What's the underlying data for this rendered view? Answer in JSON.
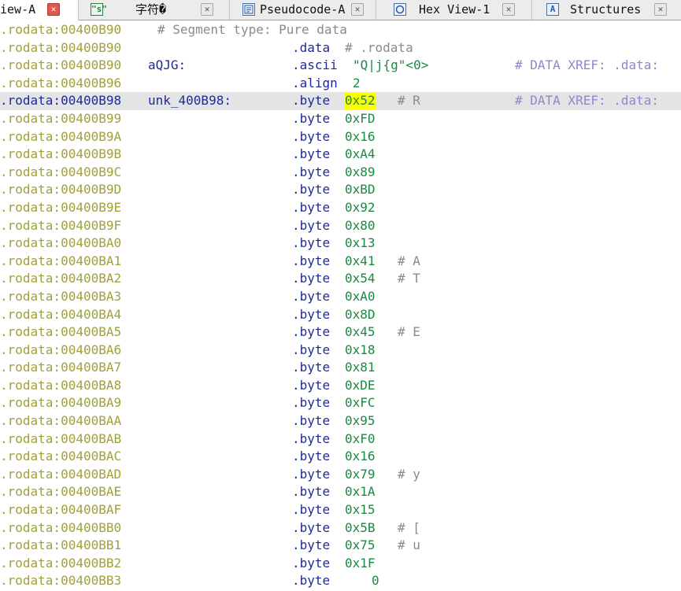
{
  "tabs": [
    {
      "label": "iew-A",
      "icon": "ida-view-icon",
      "active": true
    },
    {
      "label": "字符�",
      "icon": "strings-icon",
      "icon_glyph": "\"s\""
    },
    {
      "label": "Pseudocode-A",
      "icon": "pseudocode-icon"
    },
    {
      "label": "Hex View-1",
      "icon": "hex-view-icon"
    },
    {
      "label": "Structures",
      "icon": "structures-icon",
      "icon_glyph": "A"
    }
  ],
  "close_glyph": "✕",
  "listing": {
    "segment_comment": "# Segment type: Pure data",
    "data_directive": ".data",
    "data_comment": "# .rodata",
    "string_label": "aQJG:",
    "string_directive": ".ascii",
    "string_value": "\"Q|j{g\"<0>",
    "align_directive": ".align",
    "align_value": "2",
    "xref_text": "# DATA XREF: .data:",
    "byte_label": "unk_400B98:",
    "byte_directive": ".byte",
    "addresses": {
      "seg": ".rodata:00400B90",
      "data": ".rodata:00400B90",
      "ascii": ".rodata:00400B90",
      "align": ".rodata:00400B96"
    },
    "bytes": [
      {
        "addr": ".rodata:00400B98",
        "value": "0x52",
        "comment": "# R"
      },
      {
        "addr": ".rodata:00400B99",
        "value": "0xFD",
        "comment": ""
      },
      {
        "addr": ".rodata:00400B9A",
        "value": "0x16",
        "comment": ""
      },
      {
        "addr": ".rodata:00400B9B",
        "value": "0xA4",
        "comment": ""
      },
      {
        "addr": ".rodata:00400B9C",
        "value": "0x89",
        "comment": ""
      },
      {
        "addr": ".rodata:00400B9D",
        "value": "0xBD",
        "comment": ""
      },
      {
        "addr": ".rodata:00400B9E",
        "value": "0x92",
        "comment": ""
      },
      {
        "addr": ".rodata:00400B9F",
        "value": "0x80",
        "comment": ""
      },
      {
        "addr": ".rodata:00400BA0",
        "value": "0x13",
        "comment": ""
      },
      {
        "addr": ".rodata:00400BA1",
        "value": "0x41",
        "comment": "# A"
      },
      {
        "addr": ".rodata:00400BA2",
        "value": "0x54",
        "comment": "# T"
      },
      {
        "addr": ".rodata:00400BA3",
        "value": "0xA0",
        "comment": ""
      },
      {
        "addr": ".rodata:00400BA4",
        "value": "0x8D",
        "comment": ""
      },
      {
        "addr": ".rodata:00400BA5",
        "value": "0x45",
        "comment": "# E"
      },
      {
        "addr": ".rodata:00400BA6",
        "value": "0x18",
        "comment": ""
      },
      {
        "addr": ".rodata:00400BA7",
        "value": "0x81",
        "comment": ""
      },
      {
        "addr": ".rodata:00400BA8",
        "value": "0xDE",
        "comment": ""
      },
      {
        "addr": ".rodata:00400BA9",
        "value": "0xFC",
        "comment": ""
      },
      {
        "addr": ".rodata:00400BAA",
        "value": "0x95",
        "comment": ""
      },
      {
        "addr": ".rodata:00400BAB",
        "value": "0xF0",
        "comment": ""
      },
      {
        "addr": ".rodata:00400BAC",
        "value": "0x16",
        "comment": ""
      },
      {
        "addr": ".rodata:00400BAD",
        "value": "0x79",
        "comment": "# y"
      },
      {
        "addr": ".rodata:00400BAE",
        "value": "0x1A",
        "comment": ""
      },
      {
        "addr": ".rodata:00400BAF",
        "value": "0x15",
        "comment": ""
      },
      {
        "addr": ".rodata:00400BB0",
        "value": "0x5B",
        "comment": "# ["
      },
      {
        "addr": ".rodata:00400BB1",
        "value": "0x75",
        "comment": "# u"
      },
      {
        "addr": ".rodata:00400BB2",
        "value": "0x1F",
        "comment": ""
      },
      {
        "addr": ".rodata:00400BB3",
        "value": "0",
        "comment": ""
      }
    ]
  },
  "colors": {
    "address": "#a0a03c",
    "keyword": "#1e2a9c",
    "operand": "#1a8a42",
    "comment": "#8a8a8a",
    "xref": "#8a8acc",
    "highlight_line": "#e4e4e4",
    "cursor_highlight": "#ffff00"
  }
}
